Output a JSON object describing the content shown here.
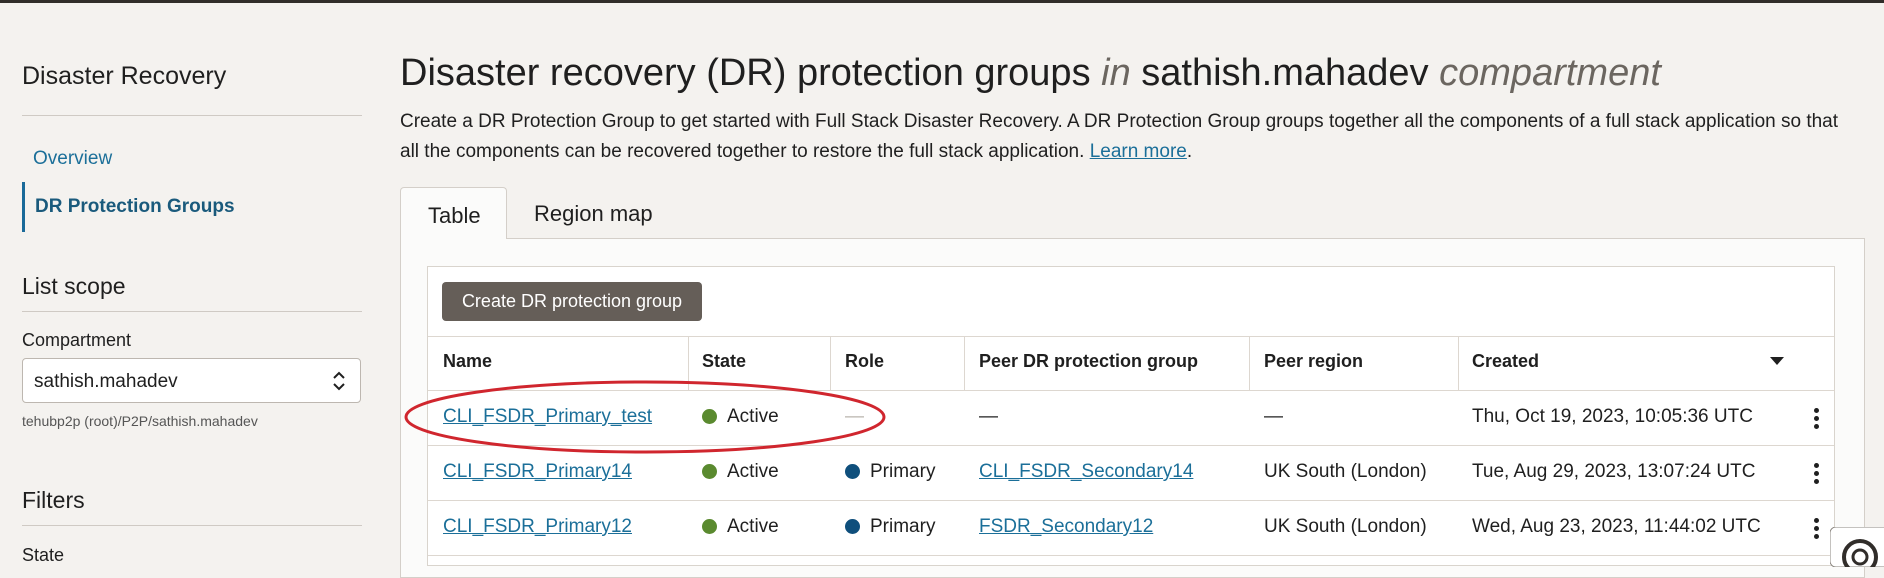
{
  "sidebar": {
    "title": "Disaster Recovery",
    "nav": [
      {
        "label": "Overview"
      },
      {
        "label": "DR Protection Groups"
      }
    ],
    "list_scope": {
      "heading": "List scope",
      "compartment_label": "Compartment",
      "compartment_value": "sathish.mahadev",
      "compartment_path": "tehubp2p (root)/P2P/sathish.mahadev"
    },
    "filters": {
      "heading": "Filters",
      "state_label": "State"
    }
  },
  "header": {
    "title_main": "Disaster recovery (DR) protection groups",
    "title_in": "in",
    "title_compartment": "sathish.mahadev",
    "title_suffix": "compartment",
    "description": "Create a DR Protection Group to get started with Full Stack Disaster Recovery. A DR Protection Group groups together all the components of a full stack application so that all the components can be recovered together to restore the full stack application.",
    "learn_more": "Learn more",
    "period": "."
  },
  "tabs": [
    {
      "label": "Table"
    },
    {
      "label": "Region map"
    }
  ],
  "toolbar": {
    "create_label": "Create DR protection group"
  },
  "table": {
    "columns": [
      "Name",
      "State",
      "Role",
      "Peer DR protection group",
      "Peer region",
      "Created"
    ],
    "rows": [
      {
        "name": "CLI_FSDR_Primary_test",
        "state": "Active",
        "role": "—",
        "peer_group": "—",
        "peer_region": "—",
        "created": "Thu, Oct 19, 2023, 10:05:36 UTC"
      },
      {
        "name": "CLI_FSDR_Primary14",
        "state": "Active",
        "role": "Primary",
        "peer_group": "CLI_FSDR_Secondary14",
        "peer_region": "UK South (London)",
        "created": "Tue, Aug 29, 2023, 13:07:24 UTC"
      },
      {
        "name": "CLI_FSDR_Primary12",
        "state": "Active",
        "role": "Primary",
        "peer_group": "FSDR_Secondary12",
        "peer_region": "UK South (London)",
        "created": "Wed, Aug 23, 2023, 11:44:02 UTC"
      }
    ]
  },
  "colors": {
    "accent_link": "#1b6f99",
    "state_active": "#5a8a2f",
    "role_primary": "#0f4f7c",
    "button_bg": "#655e58",
    "annotation": "#d0262e"
  }
}
